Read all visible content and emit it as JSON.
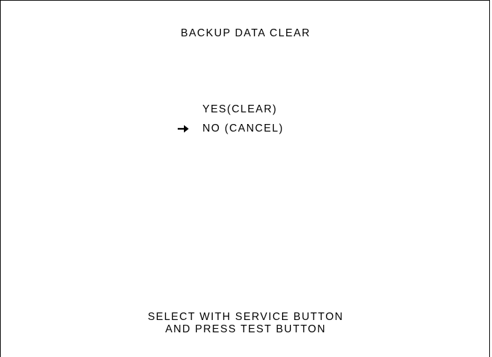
{
  "screen": {
    "title": "BACKUP DATA CLEAR",
    "menu": {
      "options": [
        {
          "label": "YES(CLEAR)",
          "selected": false
        },
        {
          "label": "NO (CANCEL)",
          "selected": true
        }
      ],
      "cursor_icon": "arrow-right-icon"
    },
    "instructions": {
      "line1": "SELECT WITH SERVICE BUTTON",
      "line2": "AND PRESS TEST BUTTON"
    }
  },
  "colors": {
    "background": "#ffffff",
    "text": "#000000"
  }
}
